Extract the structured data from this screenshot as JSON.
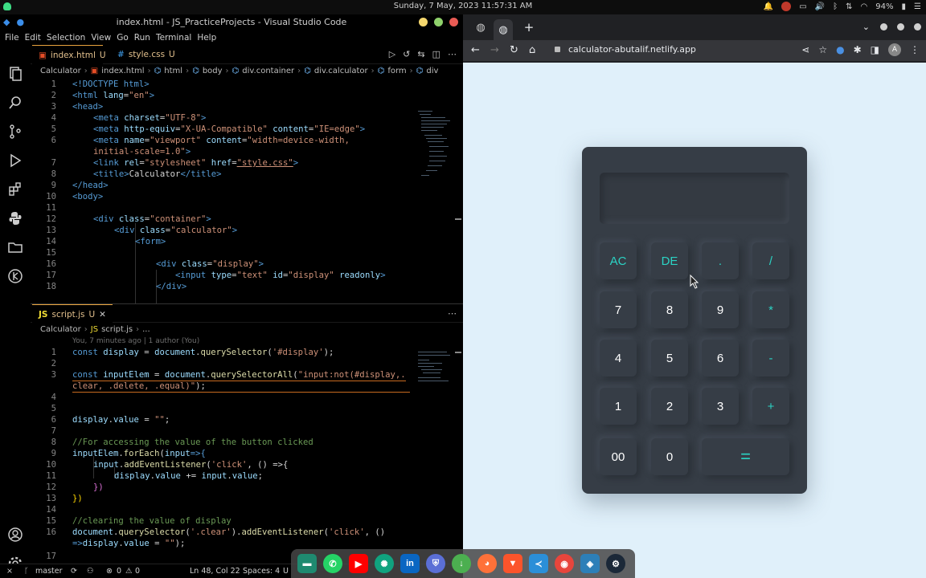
{
  "system": {
    "clock": "Sunday, 7 May, 2023   11:57:31 AM",
    "battery": "94%"
  },
  "vscode": {
    "title": "index.html - JS_PracticeProjects - Visual Studio Code",
    "menu": [
      "File",
      "Edit",
      "Selection",
      "View",
      "Go",
      "Run",
      "Terminal",
      "Help"
    ],
    "top_tabs": [
      {
        "label": "index.html",
        "status": "U"
      },
      {
        "label": "style.css",
        "status": "U"
      }
    ],
    "top_breadcrumb": [
      "Calculator",
      "index.html",
      "html",
      "body",
      "div.container",
      "div.calculator",
      "form",
      "div"
    ],
    "html_lines": [
      {
        "n": "1"
      },
      {
        "n": "2"
      },
      {
        "n": "3"
      },
      {
        "n": "4"
      },
      {
        "n": "5"
      },
      {
        "n": "6"
      },
      {
        "n": ""
      },
      {
        "n": "7"
      },
      {
        "n": "8"
      },
      {
        "n": "9"
      },
      {
        "n": "10"
      },
      {
        "n": "11"
      },
      {
        "n": "12"
      },
      {
        "n": "13"
      },
      {
        "n": "14"
      },
      {
        "n": "15"
      },
      {
        "n": "16"
      },
      {
        "n": "17"
      },
      {
        "n": "18"
      }
    ],
    "html_text": {
      "l1a": "<!DOCTYPE",
      "l1b": " html>",
      "l2a": "<html",
      "l2b": " lang",
      "l2c": "=",
      "l2d": "\"en\"",
      "l2e": ">",
      "l3": "<head>",
      "l4a": "<meta",
      "l4b": " charset",
      "l4c": "=",
      "l4d": "\"UTF-8\"",
      "l4e": ">",
      "l5a": "<meta",
      "l5b": " http-equiv",
      "l5c": "=",
      "l5d": "\"X-UA-Compatible\"",
      "l5e": " content",
      "l5f": "=",
      "l5g": "\"IE=edge\"",
      "l5h": ">",
      "l6a": "<meta",
      "l6b": " name",
      "l6c": "=",
      "l6d": "\"viewport\"",
      "l6e": " content",
      "l6f": "=",
      "l6g": "\"width=device-width,",
      "l6w": "initial-scale=1.0\"",
      "l6x": ">",
      "l7a": "<link",
      "l7b": " rel",
      "l7c": "=",
      "l7d": "\"stylesheet\"",
      "l7e": " href",
      "l7f": "=",
      "l7g": "\"style.css\"",
      "l7h": ">",
      "l8a": "<title>",
      "l8b": "Calculator",
      "l8c": "</title>",
      "l9": "</head>",
      "l10": "<body>",
      "l12a": "<div",
      "l12b": " class",
      "l12c": "=",
      "l12d": "\"container\"",
      "l12e": ">",
      "l13a": "<div",
      "l13b": " class",
      "l13c": "=",
      "l13d": "\"calculator\"",
      "l13e": ">",
      "l14": "<form>",
      "l16a": "<div",
      "l16b": " class",
      "l16c": "=",
      "l16d": "\"display\"",
      "l16e": ">",
      "l17a": "<input",
      "l17b": " type",
      "l17c": "=",
      "l17d": "\"text\"",
      "l17e": " id",
      "l17f": "=",
      "l17g": "\"display\"",
      "l17h": " readonly",
      "l17i": ">",
      "l18": "</div>"
    },
    "bottom_tab": {
      "label": "script.js",
      "status": "U"
    },
    "bottom_breadcrumb": [
      "Calculator",
      "script.js",
      "..."
    ],
    "blame": "You, 7 minutes ago | 1 author (You)",
    "js_numbers": [
      "1",
      "2",
      "3",
      "",
      "4",
      "5",
      "6",
      "7",
      "8",
      "9",
      "10",
      "11",
      "12",
      "13",
      "14",
      "15",
      "16",
      "",
      "17"
    ],
    "js_text": {
      "l1a": "const",
      "l1b": " display",
      "l1c": " = ",
      "l1d": "document",
      "l1e": ".",
      "l1f": "querySelector",
      "l1g": "(",
      "l1h": "'#display'",
      "l1i": ");",
      "l3a": "const",
      "l3b": " inputElem",
      "l3c": " = ",
      "l3d": "document",
      "l3e": ".",
      "l3f": "querySelectorAll",
      "l3g": "(",
      "l3h": "\"input:not(#display,.",
      "l3w": "clear, .delete, .equal)\"",
      "l3x": ");",
      "l6a": "display",
      "l6b": ".",
      "l6c": "value",
      "l6d": " = ",
      "l6e": "\"\"",
      "l6f": ";",
      "l8": "//For accessing the value of the button clicked",
      "l9a": "inputElem",
      "l9b": ".",
      "l9c": "forEach",
      "l9d": "(",
      "l9e": "input",
      "l9f": "=>{",
      "l10a": "input",
      "l10b": ".",
      "l10c": "addEventListener",
      "l10d": "(",
      "l10e": "'click'",
      "l10f": ", () =>{",
      "l11a": "display",
      "l11b": ".",
      "l11c": "value",
      "l11d": " += ",
      "l11e": "input",
      "l11f": ".",
      "l11g": "value",
      "l11h": ";",
      "l12": "})",
      "l13": "})",
      "l15": "//clearing the value of display",
      "l16a": "document",
      "l16b": ".",
      "l16c": "querySelector",
      "l16d": "(",
      "l16e": "'.clear'",
      "l16f": ").",
      "l16g": "addEventListener",
      "l16h": "(",
      "l16i": "'click'",
      "l16j": ", ()",
      "l16w": "=>",
      "l16x": "display",
      "l16y": ".",
      "l16z": "value",
      "l16q": " = ",
      "l16r": "\"\"",
      "l16s": ");"
    },
    "status": {
      "branch": "master",
      "problems": "0",
      "warnings": "0",
      "position": "Ln 48, Col 22",
      "spaces": "Spaces: 4",
      "encoding": "U"
    }
  },
  "chrome": {
    "url": "calculator-abutalif.netlify.app",
    "profile": "A"
  },
  "calculator": {
    "display_value": "",
    "keys": [
      {
        "label": "AC",
        "kind": "op"
      },
      {
        "label": "DE",
        "kind": "op"
      },
      {
        "label": ".",
        "kind": "op"
      },
      {
        "label": "/",
        "kind": "op"
      },
      {
        "label": "7",
        "kind": "num"
      },
      {
        "label": "8",
        "kind": "num"
      },
      {
        "label": "9",
        "kind": "num"
      },
      {
        "label": "*",
        "kind": "op"
      },
      {
        "label": "4",
        "kind": "num"
      },
      {
        "label": "5",
        "kind": "num"
      },
      {
        "label": "6",
        "kind": "num"
      },
      {
        "label": "-",
        "kind": "op"
      },
      {
        "label": "1",
        "kind": "num"
      },
      {
        "label": "2",
        "kind": "num"
      },
      {
        "label": "3",
        "kind": "num"
      },
      {
        "label": "+",
        "kind": "op"
      },
      {
        "label": "00",
        "kind": "num"
      },
      {
        "label": "0",
        "kind": "num"
      },
      {
        "label": "=",
        "kind": "eq"
      }
    ],
    "accent_color": "#2bd3c4"
  },
  "dock": {
    "apps": [
      "files",
      "whatsapp",
      "youtube",
      "chatgpt",
      "linkedin",
      "brave-shield",
      "download",
      "firefox",
      "brave",
      "vscode",
      "chrome",
      "network",
      "steam"
    ]
  }
}
